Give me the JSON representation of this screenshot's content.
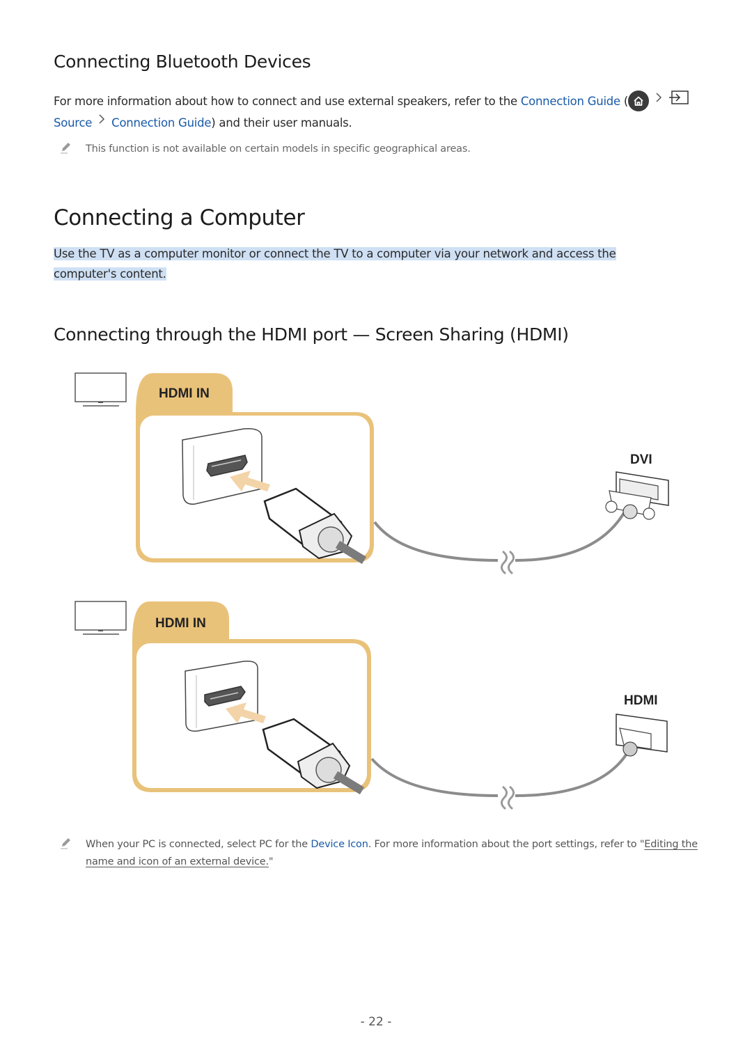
{
  "sections": {
    "bluetooth": {
      "heading": "Connecting Bluetooth Devices",
      "para_prefix": "For more information about how to connect and use external speakers, refer to the ",
      "link_connection_guide": "Connection Guide",
      "open_paren": " (",
      "path_source": "Source",
      "path_connection_guide": "Connection Guide",
      "para_suffix": ") and their user manuals.",
      "note": "This function is not available on certain models in specific geographical areas."
    },
    "computer": {
      "heading": "Connecting a Computer",
      "intro": "Use the TV as a computer monitor or connect the TV to a computer via your network and access the computer's content."
    },
    "hdmi": {
      "heading": "Connecting through the HDMI port — Screen Sharing (HDMI)",
      "diagrams": [
        {
          "tab_label": "HDMI IN",
          "end_label": "DVI"
        },
        {
          "tab_label": "HDMI IN",
          "end_label": "HDMI"
        }
      ],
      "note_prefix": "When your PC is connected, select PC for the ",
      "note_link": "Device Icon",
      "note_middle": ". For more information about the port settings, refer to \"",
      "note_ref": "Editing the name and icon of an external device.",
      "note_suffix": "\""
    }
  },
  "icons": {
    "home": "home-icon",
    "chevron": "chevron-right-icon",
    "source": "source-input-icon",
    "note": "pencil-note-icon",
    "tv": "tv-icon"
  },
  "colors": {
    "link": "#1a5aa8",
    "highlight": "#cfe0f4",
    "accent_tab": "#e9c27a",
    "cable": "#8c8c8c"
  },
  "footer": {
    "page_number": "- 22 -"
  }
}
